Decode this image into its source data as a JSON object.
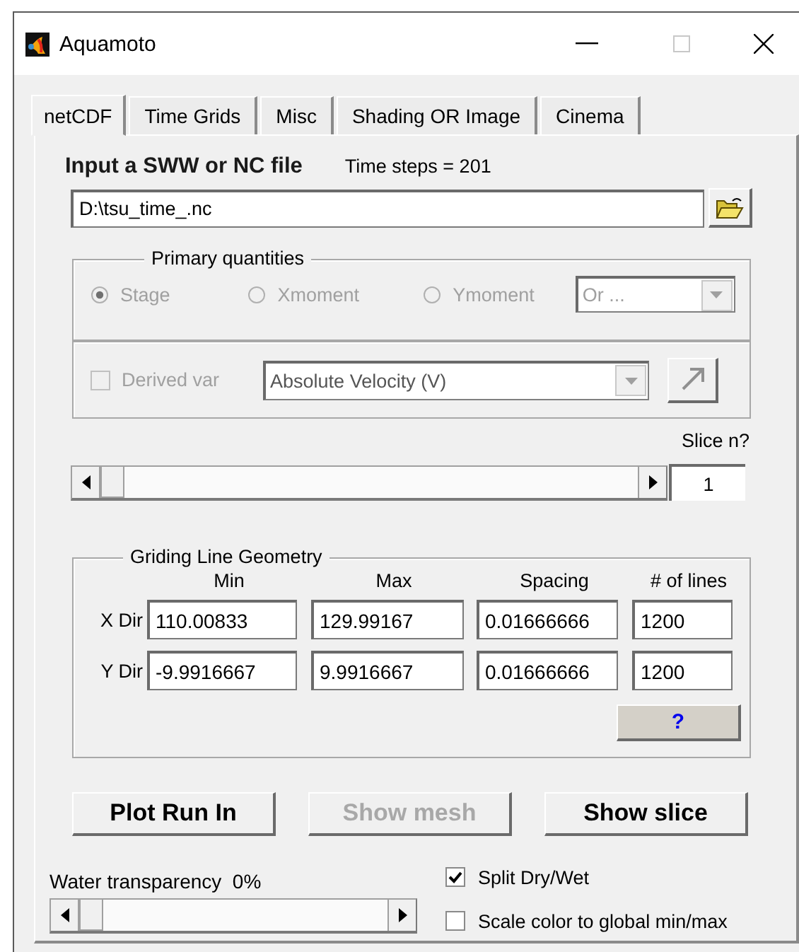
{
  "window": {
    "title": "Aquamoto"
  },
  "tabs": [
    {
      "label": "netCDF",
      "selected": true
    },
    {
      "label": "Time Grids",
      "selected": false
    },
    {
      "label": "Misc",
      "selected": false
    },
    {
      "label": "Shading OR Image",
      "selected": false
    },
    {
      "label": "Cinema",
      "selected": false
    }
  ],
  "input": {
    "label": "Input a SWW or NC file",
    "time_steps": "Time steps = 201",
    "file_path": "D:\\tsu_time_.nc"
  },
  "primary_quantities": {
    "title": "Primary quantities",
    "disabled": true,
    "options": [
      {
        "label": "Stage",
        "selected": true
      },
      {
        "label": "Xmoment",
        "selected": false
      },
      {
        "label": "Ymoment",
        "selected": false
      }
    ],
    "dropdown": "Or ..."
  },
  "derived": {
    "label": "Derived var",
    "checked": false,
    "disabled": true,
    "dropdown": "Absolute Velocity (V)"
  },
  "slice": {
    "label": "Slice n?",
    "level": 0,
    "value": "1"
  },
  "grid": {
    "title": "Griding Line Geometry",
    "columns": [
      "Min",
      "Max",
      "Spacing",
      "# of lines"
    ],
    "rows": [
      {
        "label": "X Dir",
        "values": [
          "110.00833",
          "129.99167",
          "0.01666666",
          "1200"
        ]
      },
      {
        "label": "Y Dir",
        "values": [
          "-9.9916667",
          "9.9916667",
          "0.01666666",
          "1200"
        ]
      }
    ],
    "help_button": "?"
  },
  "buttons": [
    {
      "label": "Plot Run In",
      "disabled": false
    },
    {
      "label": "Show mesh",
      "disabled": true
    },
    {
      "label": "Show slice",
      "disabled": false
    }
  ],
  "transparency": {
    "label": "Water transparency",
    "reading": "0%",
    "level": 0
  },
  "options": [
    {
      "label": "Split Dry/Wet",
      "checked": true
    },
    {
      "label": "Scale color to global min/max",
      "checked": false
    }
  ]
}
